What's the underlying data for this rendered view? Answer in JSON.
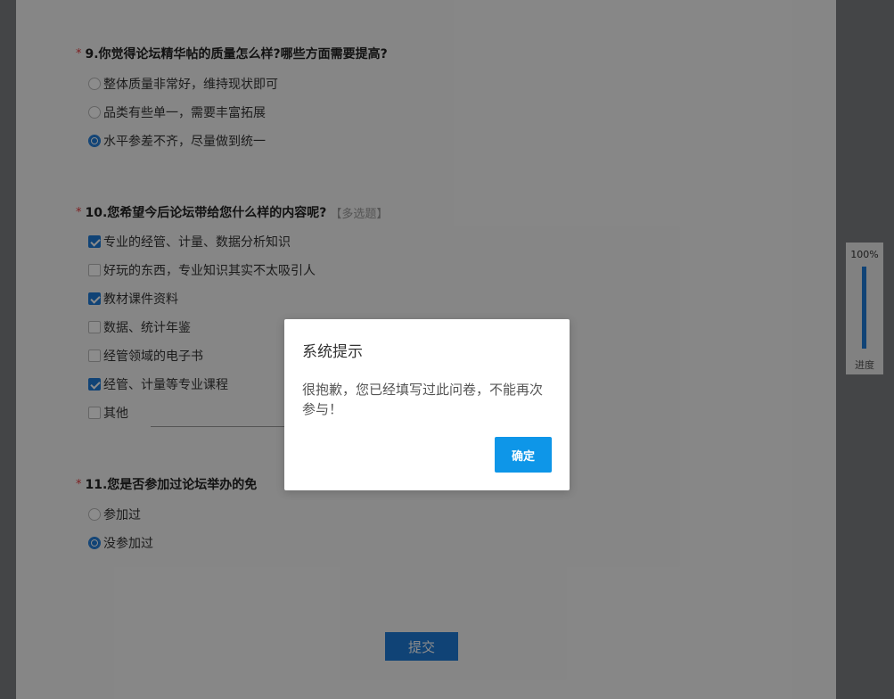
{
  "questions": [
    {
      "number_title": "9.你觉得论坛精华帖的质量怎么样?哪些方面需要提高?",
      "required_mark": "*",
      "options": [
        {
          "label": "整体质量非常好，维持现状即可",
          "selected": false
        },
        {
          "label": "品类有些单一，需要丰富拓展",
          "selected": false
        },
        {
          "label": "水平参差不齐，尽量做到统一",
          "selected": true
        }
      ]
    },
    {
      "number_title": "10.您希望今后论坛带给您什么样的内容呢?",
      "multi_tag": "【多选题】",
      "required_mark": "*",
      "options": [
        {
          "label": "专业的经管、计量、数据分析知识",
          "checked": true
        },
        {
          "label": "好玩的东西，专业知识其实不太吸引人",
          "checked": false
        },
        {
          "label": "教材课件资料",
          "checked": true
        },
        {
          "label": "数据、统计年鉴",
          "checked": false
        },
        {
          "label": "经管领域的电子书",
          "checked": false
        },
        {
          "label": "经管、计量等专业课程",
          "checked": true
        },
        {
          "label": "其他",
          "checked": false
        }
      ]
    },
    {
      "number_title": "11.您是否参加过论坛举办的免",
      "required_mark": "*",
      "options": [
        {
          "label": "参加过",
          "selected": false
        },
        {
          "label": "没参加过",
          "selected": true
        }
      ]
    }
  ],
  "submit_label": "提交",
  "progress": {
    "value": "100%",
    "label": "进度",
    "fraction": 1.0
  },
  "dialog": {
    "title": "系统提示",
    "message": "很抱歉，您已经填写过此问卷，不能再次参与！",
    "ok_label": "确定"
  },
  "colors": {
    "accent": "#1e7ad8",
    "dialog_button": "#0e96e8",
    "required": "#e4393c"
  }
}
